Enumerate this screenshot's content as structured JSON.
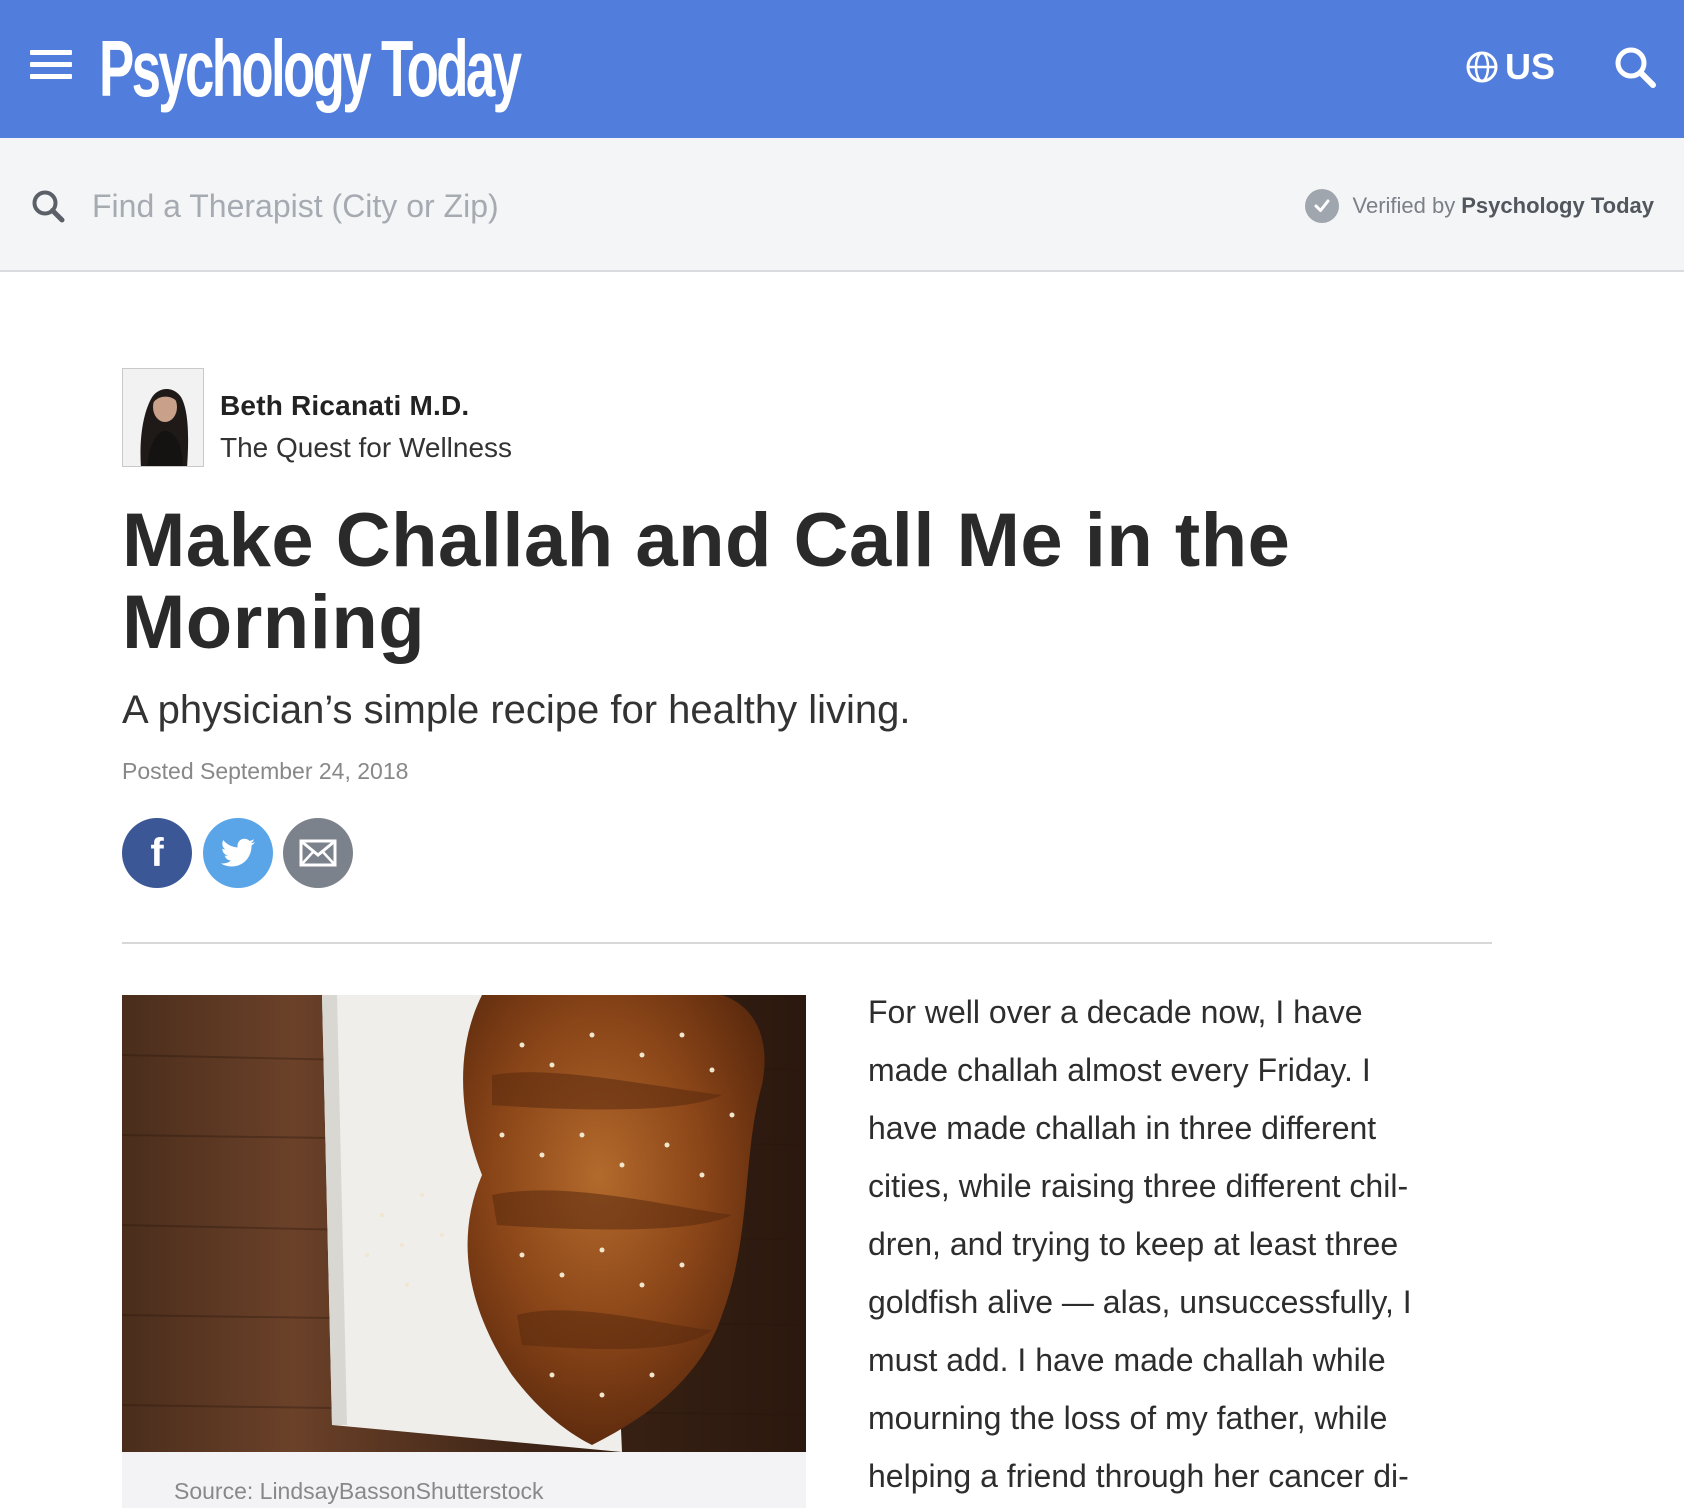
{
  "header": {
    "logo_text": "Psychology Today",
    "region_label": "US",
    "brand_color": "#517ddc"
  },
  "therapist_search": {
    "placeholder": "Find a Therapist (City or Zip)",
    "verified_prefix": "Verified by",
    "verified_brand": "Psychology Today"
  },
  "author": {
    "name": "Beth Ricanati M.D.",
    "blog": "The Quest for Wellness"
  },
  "article": {
    "title": "Make Challah and Call Me in the Morning",
    "subtitle": "A physician’s simple recipe for healthy living.",
    "posted": "Posted September 24, 2018",
    "image_caption": "Source: LindsayBassonShutterstock",
    "body_lines": [
      "For well over a decade now, I have",
      "made challah almost every Friday. I",
      "have made challah in three different",
      "cities, while raising three different chil-",
      "dren, and trying to keep at least three",
      "goldfish alive — alas, unsuccessfully, I",
      "must add. I have made challah while",
      "mourning the loss of my father, while",
      "helping a friend through her cancer di-"
    ]
  },
  "share": {
    "facebook_color": "#3b5796",
    "twitter_color": "#5aa5e8",
    "email_color": "#7c828b",
    "icons": [
      "facebook-icon",
      "twitter-icon",
      "email-icon"
    ]
  }
}
